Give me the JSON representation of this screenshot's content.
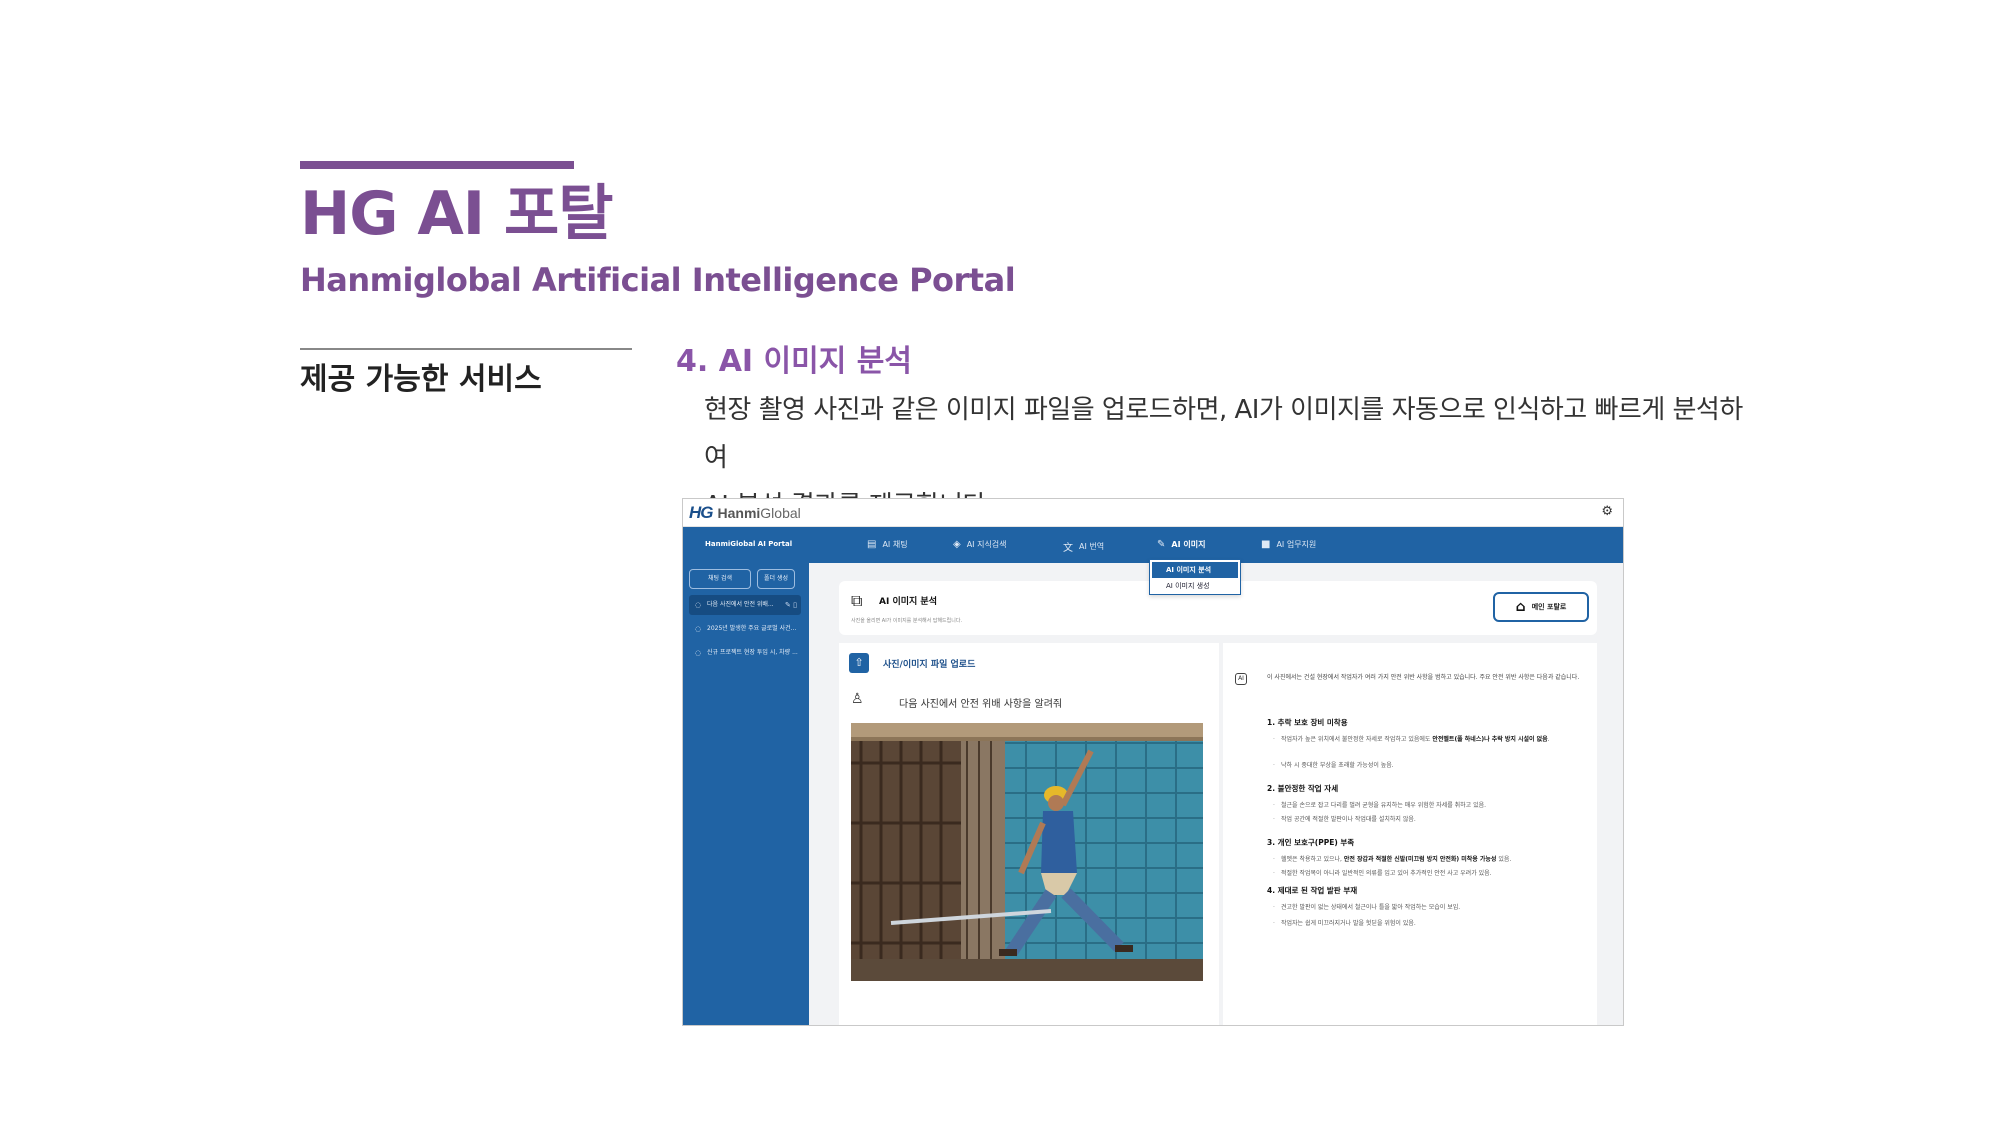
{
  "slide": {
    "title": "HG AI 포탈",
    "subtitle": "Hanmiglobal Artificial Intelligence Portal",
    "section_label": "제공 가능한 서비스",
    "item_heading": "4.  AI 이미지 분석",
    "item_desc_line1": "현장 촬영 사진과 같은 이미지 파일을 업로드하면, AI가 이미지를 자동으로 인식하고 빠르게 분석하여",
    "item_desc_line2": "AI 분석 결과를 제공합니다."
  },
  "app": {
    "brand_mark": "HG",
    "brand_name_bold": "Hanmi",
    "brand_name_light": "Global",
    "portal_name": "HanmiGlobal AI Portal",
    "nav": [
      {
        "label": "AI 채팅",
        "icon": "chat-icon"
      },
      {
        "label": "AI 지식검색",
        "icon": "graduation-cap-icon"
      },
      {
        "label": "AI 번역",
        "icon": "translate-icon"
      },
      {
        "label": "AI 이미지",
        "icon": "pencil-icon"
      },
      {
        "label": "AI 업무지원",
        "icon": "briefcase-icon"
      }
    ],
    "dropdown": [
      "AI 이미지 분석",
      "AI 이미지 생성"
    ],
    "sidebar": {
      "search_btn": "채팅 검색",
      "new_btn": "폴더 생성",
      "items": [
        "다음 사진에서 안전 위배...",
        "2025년 발생한 주요 글로벌 사건...",
        "신규 프로젝트 현장 투입 시, 차량 ..."
      ]
    },
    "page": {
      "title": "AI 이미지 분석",
      "subtitle": "사진을 올리면 AI가 이미지를 분석해서 답해드립니다.",
      "home_btn": "메인 포탈로"
    },
    "upload": {
      "title": "사진/이미지 파일 업로드",
      "prompt": "다음 사진에서 안전 위배 사항을 알려줘"
    },
    "result": {
      "badge": "AI",
      "intro": "이 사진에서는 건설 현장에서 작업자가 여러 가지 안전 위반 사항을 범하고 있습니다. 주요 안전 위반 사항은 다음과 같습니다.",
      "s1": "1. 추락 보호 장비 미착용",
      "s1b1_pre": "작업자가 높은 위치에서 불안정한 자세로 작업하고 있음에도 ",
      "s1b1_bold": "안전벨트(풀 하네스)나 추락 방지 시설이 없음",
      "s1b1_post": ".",
      "s1b2": "낙하 시 중대한 부상을 초래할 가능성이 높음.",
      "s2": "2. 불안정한 작업 자세",
      "s2b1": "철근을 손으로 잡고 다리를 벌려 균형을 유지하는 매우 위험한 자세를 취하고 있음.",
      "s2b2": "작업 공간에 적절한 발판이나 작업대를 설치하지 않음.",
      "s3": "3. 개인 보호구(PPE) 부족",
      "s3b1_pre": "헬멧은 착용하고 있으나, ",
      "s3b1_bold": "안전 장갑과 적절한 신발(미끄럼 방지 안전화) 미착용 가능성",
      "s3b1_post": " 있음.",
      "s3b2": "적절한 작업복이 아니라 일반적인 의류를 입고 있어 추가적인 안전 사고 우려가 있음.",
      "s4": "4. 제대로 된 작업 발판 부재",
      "s4b1": "견고한 발판이 없는 상태에서 철근이나 틀을 밟아 작업하는 모습이 보임.",
      "s4b2": "작업자는 쉽게 미끄러지거나 발을 헛딛을 위험이 있음."
    }
  },
  "colors": {
    "brand_purple": "#7b4f92",
    "heading_purple": "#8a55a8",
    "app_blue": "#2063a4"
  }
}
